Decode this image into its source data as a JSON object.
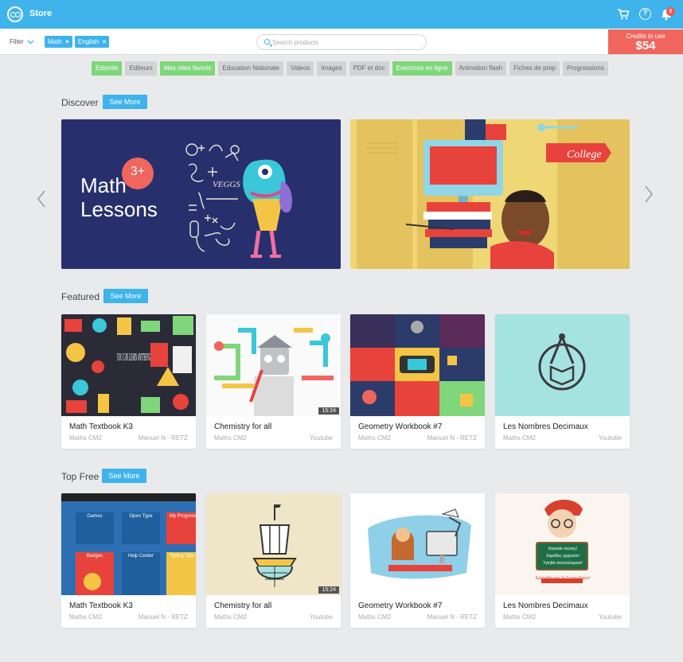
{
  "app": {
    "title": "Store",
    "notifications": "6"
  },
  "filter": {
    "label": "Filter",
    "chips": [
      "Math",
      "English"
    ],
    "remove_glyph": "×"
  },
  "search": {
    "placeholder": "Search products"
  },
  "credits": {
    "label": "Credits to use",
    "value": "$54"
  },
  "tags": [
    {
      "label": "Edsmile",
      "active": true
    },
    {
      "label": "Editeurs",
      "active": false
    },
    {
      "label": "Mes sites favoris",
      "active": true
    },
    {
      "label": "Education Nationale",
      "active": false
    },
    {
      "label": "Videos",
      "active": false
    },
    {
      "label": "Images",
      "active": false
    },
    {
      "label": "PDF et doc",
      "active": false
    },
    {
      "label": "Exercices en ligne",
      "active": true
    },
    {
      "label": "Animation flash",
      "active": false
    },
    {
      "label": "Fiches de prep",
      "active": false
    },
    {
      "label": "Progressions",
      "active": false
    }
  ],
  "discover": {
    "title": "Discover",
    "see_more": "See More",
    "banner1": {
      "line1": "Math",
      "line2": "Lessons",
      "badge": "3+",
      "chalk_word": "VEGGS"
    },
    "banner2": {
      "sign": "College"
    },
    "prev_glyph": "‹",
    "next_glyph": "›"
  },
  "featured": {
    "title": "Featured",
    "see_more": "See More",
    "cards": [
      {
        "title": "Math  Textbook K3",
        "subject": "Maths CM2",
        "source": "Manuel N - RETZ",
        "art_text": "YOU CAN LEARN ANYTHING"
      },
      {
        "title": "Chemistry for all",
        "subject": "Maths CM2",
        "source": "Youtube",
        "duration": "15:24"
      },
      {
        "title": "Geometry Workbook #7",
        "subject": "Maths CM2",
        "source": "Manuel N - RETZ"
      },
      {
        "title": "Les Nombres Decimaux",
        "subject": "Maths CM2",
        "source": "Youtube"
      }
    ]
  },
  "topfree": {
    "title": "Top Free",
    "see_more": "See More",
    "cards": [
      {
        "title": "Math  Textbook K3",
        "subject": "Maths CM2",
        "source": "Manuel N - RETZ",
        "panels": [
          "Games",
          "Open Type",
          "My Progress",
          "Badges",
          "Help Center",
          "Typing Tips"
        ]
      },
      {
        "title": "Chemistry for all",
        "subject": "Maths CM2",
        "source": "Youtube",
        "duration": "15:24"
      },
      {
        "title": "Geometry Workbook #7",
        "subject": "Maths CM2",
        "source": "Manuel N - RETZ"
      },
      {
        "title": "Les Nombres Decimaux",
        "subject": "Maths CM2",
        "source": "Youtube",
        "board": [
          "Καγκαία πεύτης!",
          "Χαρτίδες αρχίσατε!",
          "Υγιηδά αποτελέσματα!"
        ],
        "caption": "Εργορίδα ακό 1η Σεπτεμβρίου!"
      }
    ]
  },
  "colors": {
    "accent": "#3eb3ec",
    "credits_bg": "#f0655e",
    "tag_active": "#7fd67b",
    "tag_inactive": "#d2d3d5",
    "background": "#e9eaec"
  },
  "icons": [
    "logo-icon",
    "cart-icon",
    "help-icon",
    "bell-icon",
    "chevron-down-icon",
    "search-icon",
    "chevron-left-icon",
    "chevron-right-icon"
  ]
}
